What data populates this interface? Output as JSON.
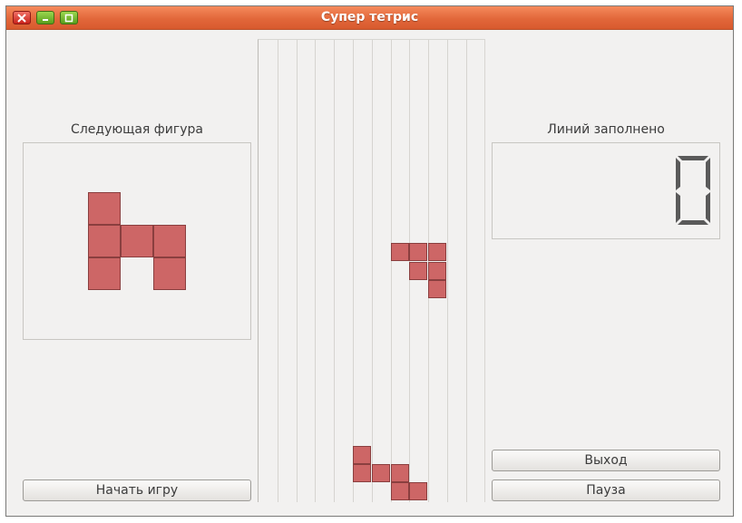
{
  "window": {
    "title": "Супер тетрис"
  },
  "left": {
    "next_label": "Следующая фигура",
    "start_button": "Начать игру",
    "next_piece_cells": [
      [
        0,
        0
      ],
      [
        0,
        1
      ],
      [
        1,
        1
      ],
      [
        2,
        1
      ],
      [
        0,
        2
      ],
      [
        2,
        2
      ]
    ]
  },
  "right": {
    "lines_label": "Линий заполнено",
    "lines_value": "0",
    "exit_button": "Выход",
    "pause_button": "Пауза"
  },
  "board": {
    "columns": 12,
    "falling_piece": [
      [
        7,
        11
      ],
      [
        8,
        11
      ],
      [
        9,
        11
      ],
      [
        8,
        12
      ],
      [
        9,
        12
      ],
      [
        9,
        13
      ]
    ],
    "settled_blocks": [
      [
        5,
        22
      ],
      [
        5,
        23
      ],
      [
        6,
        23
      ],
      [
        7,
        23
      ],
      [
        7,
        24
      ],
      [
        8,
        24
      ]
    ]
  },
  "colors": {
    "block": "#cd6666",
    "titlebar": "#e2673a"
  }
}
